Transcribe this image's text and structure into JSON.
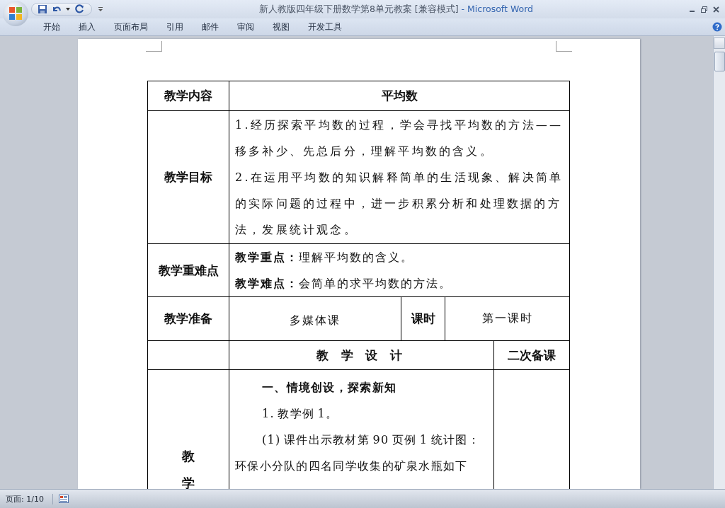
{
  "window": {
    "document_title": "新人教版四年级下册数学第8单元教案 [兼容模式]",
    "app_name": "- Microsoft Word"
  },
  "ribbon_tabs": [
    {
      "label": "开始",
      "selected": false
    },
    {
      "label": "插入",
      "selected": false
    },
    {
      "label": "页面布局",
      "selected": false
    },
    {
      "label": "引用",
      "selected": false
    },
    {
      "label": "邮件",
      "selected": false
    },
    {
      "label": "审阅",
      "selected": false
    },
    {
      "label": "视图",
      "selected": false
    },
    {
      "label": "开发工具",
      "selected": false
    }
  ],
  "lesson_table": {
    "content": {
      "label": "教学内容",
      "value": "平均数"
    },
    "objectives": {
      "label": "教学目标",
      "items": [
        "1.经历探索平均数的过程，学会寻找平均数的方法——移多补少、先总后分，理解平均数的含义。",
        "2.在运用平均数的知识解释简单的生活现象、解决简单的实际问题的过程中，进一步积累分析和处理数据的方法，发展统计观念。"
      ]
    },
    "key_points": {
      "label": "教学重难点",
      "items": [
        "**教学重点：**理解平均数的含义。",
        "**教学难点：**会简单的求平均数的方法。"
      ]
    },
    "preparation": {
      "label": "教学准备",
      "value": "多媒体课",
      "period_label": "课时",
      "period": "第一课时"
    },
    "design_header": {
      "title": "教 学 设 计",
      "notes": "二次备课"
    },
    "process": {
      "label_chars": [
        "教",
        "学"
      ],
      "heading": "一、情境创设，探索新知",
      "paragraphs": [
        "1. 教学例 1。",
        "(1) 课件出示教材第 90 页例 1 统计图：环保小分队的四名同学收集的矿泉水瓶如下"
      ]
    }
  },
  "status_bar": {
    "page": "页面: 1/10"
  }
}
